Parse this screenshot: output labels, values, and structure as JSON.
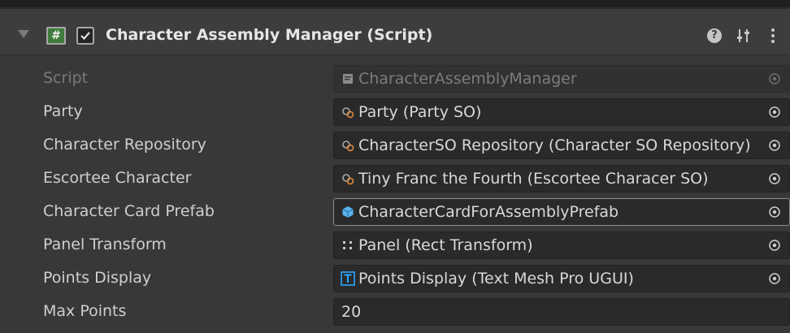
{
  "component": {
    "title": "Character Assembly Manager (Script)",
    "enabled": true,
    "icons": {
      "script": "script-icon",
      "help": "help-icon",
      "presets": "presets-icon",
      "menu": "kebab-menu-icon"
    }
  },
  "fields": [
    {
      "label": "Script",
      "value": "CharacterAssemblyManager",
      "icon": "script-asset-icon",
      "disabled": true
    },
    {
      "label": "Party",
      "value": "Party (Party SO)",
      "icon": "scriptable-object-icon"
    },
    {
      "label": "Character Repository",
      "value": "CharacterSO Repository (Character SO Repository)",
      "icon": "scriptable-object-icon"
    },
    {
      "label": "Escortee Character",
      "value": "Tiny Franc the Fourth (Escortee Characer SO)",
      "icon": "scriptable-object-icon"
    },
    {
      "label": "Character Card Prefab",
      "value": "CharacterCardForAssemblyPrefab",
      "icon": "prefab-icon"
    },
    {
      "label": "Panel Transform",
      "value": "Panel (Rect Transform)",
      "icon": "rect-transform-icon"
    },
    {
      "label": "Points Display",
      "value": "Points Display (Text Mesh Pro UGUI)",
      "icon": "text-mesh-pro-icon"
    },
    {
      "label": "Max Points",
      "value": "20",
      "icon": ""
    }
  ],
  "colors": {
    "background": "#383838",
    "field": "#2a2a2a",
    "prefab_blue": "#5ab4f0",
    "tmp_blue": "#2aa7ff"
  }
}
